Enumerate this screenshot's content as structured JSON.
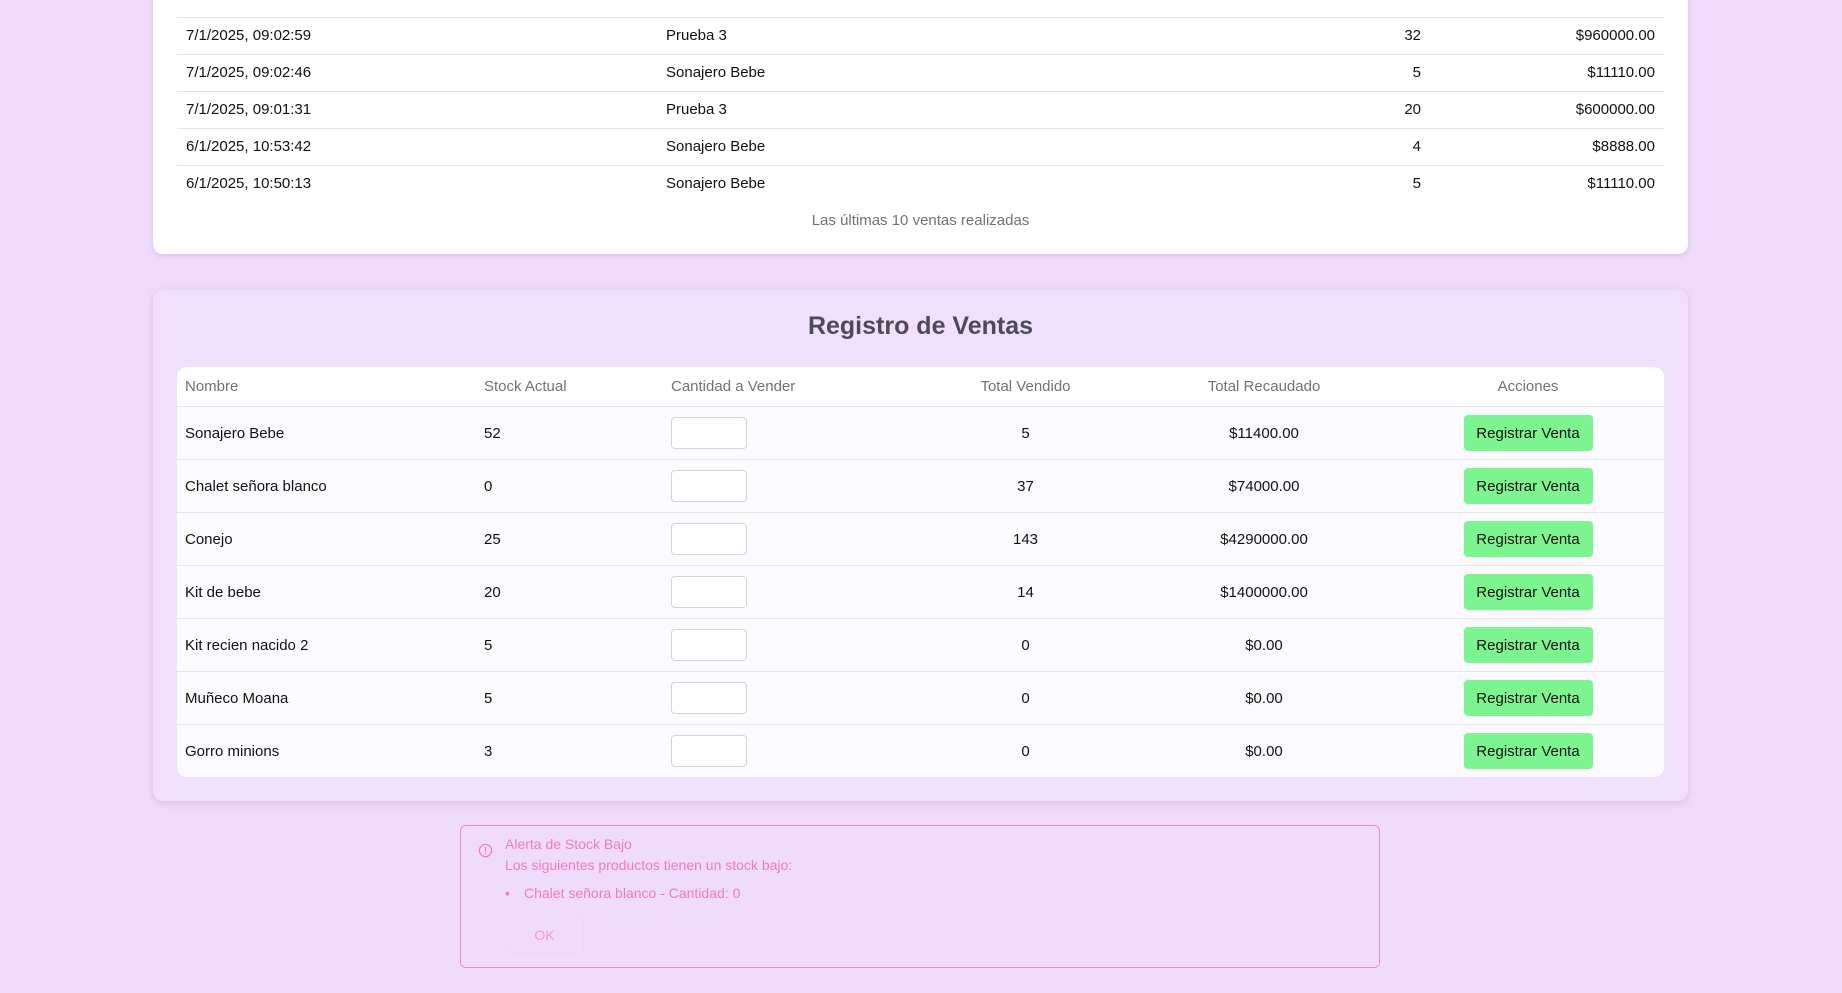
{
  "recent_sales": {
    "rows": [
      {
        "date": "7/1/2025, 09:02:59",
        "product": "Prueba 3",
        "qty": "32",
        "amount": "$960000.00"
      },
      {
        "date": "7/1/2025, 09:02:46",
        "product": "Sonajero Bebe",
        "qty": "5",
        "amount": "$11110.00"
      },
      {
        "date": "7/1/2025, 09:01:31",
        "product": "Prueba 3",
        "qty": "20",
        "amount": "$600000.00"
      },
      {
        "date": "6/1/2025, 10:53:42",
        "product": "Sonajero Bebe",
        "qty": "4",
        "amount": "$8888.00"
      },
      {
        "date": "6/1/2025, 10:50:13",
        "product": "Sonajero Bebe",
        "qty": "5",
        "amount": "$11110.00"
      }
    ],
    "caption": "Las últimas 10 ventas realizadas"
  },
  "registry": {
    "title": "Registro de Ventas",
    "headers": {
      "name": "Nombre",
      "stock": "Stock Actual",
      "qty": "Cantidad a Vender",
      "sold": "Total Vendido",
      "total": "Total Recaudado",
      "actions": "Acciones"
    },
    "button_label": "Registrar Venta",
    "rows": [
      {
        "name": "Sonajero Bebe",
        "stock": "52",
        "qty": "",
        "sold": "5",
        "total": "$11400.00"
      },
      {
        "name": "Chalet señora blanco",
        "stock": "0",
        "qty": "",
        "sold": "37",
        "total": "$74000.00"
      },
      {
        "name": "Conejo",
        "stock": "25",
        "qty": "",
        "sold": "143",
        "total": "$4290000.00"
      },
      {
        "name": "Kit de bebe",
        "stock": "20",
        "qty": "",
        "sold": "14",
        "total": "$1400000.00"
      },
      {
        "name": "Kit recien nacido 2",
        "stock": "5",
        "qty": "",
        "sold": "0",
        "total": "$0.00"
      },
      {
        "name": "Muñeco Moana",
        "stock": "5",
        "qty": "",
        "sold": "0",
        "total": "$0.00"
      },
      {
        "name": "Gorro minions",
        "stock": "3",
        "qty": "",
        "sold": "0",
        "total": "$0.00"
      }
    ]
  },
  "stock_alert": {
    "icon": "alert-circle-icon",
    "title": "Alerta de Stock Bajo",
    "description": "Los siguientes productos tienen un stock bajo:",
    "items": [
      "Chalet señora blanco - Cantidad: 0"
    ],
    "ok_label": "OK"
  },
  "colors": {
    "page_background": "#efdcfc",
    "button_green": "#7cf591",
    "alert_pink": "#f27ab6"
  }
}
